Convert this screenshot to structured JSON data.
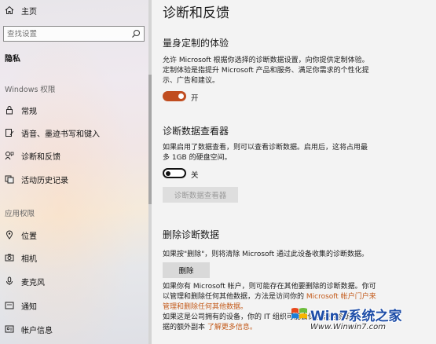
{
  "sidebar": {
    "home_label": "主页",
    "search_placeholder": "查找设置",
    "category": "隐私",
    "section_windows": "Windows 权限",
    "windows_items": [
      {
        "label": "常规"
      },
      {
        "label": "语音、墨迹书写和键入"
      },
      {
        "label": "诊断和反馈"
      },
      {
        "label": "活动历史记录"
      }
    ],
    "section_app": "应用权限",
    "app_items": [
      {
        "label": "位置"
      },
      {
        "label": "相机"
      },
      {
        "label": "麦克风"
      },
      {
        "label": "通知"
      },
      {
        "label": "帐户信息"
      }
    ]
  },
  "main": {
    "title": "诊断和反馈",
    "tailored": {
      "heading": "量身定制的体验",
      "line1": "允许 Microsoft 根据你选择的诊断数据设置，向你提供定制体验。",
      "line2": "定制体验是指提升 Microsoft 产品和服务、满足你需求的个性化提",
      "line3": "示、广告和建议。",
      "toggle_state": "开"
    },
    "viewer": {
      "heading": "诊断数据查看器",
      "line1": "如果启用了数据查看，则可以查看诊断数据。启用后，这将占用最",
      "line2": "多 1GB 的硬盘空间。",
      "toggle_state": "关",
      "button": "诊断数据查看器"
    },
    "delete": {
      "heading": "删除诊断数据",
      "line1": "如果按\"删除\"，则将清除 Microsoft 通过此设备收集的诊断数据。",
      "button": "删除",
      "p2_line1": "如果你有 Microsoft 帐户，则可能存在其他要删除的诊断数据。你可",
      "p2_line2a": "以管理和删除任何其他数据，方法是访问你的 ",
      "p2_link1": "Microsoft 帐户门户来",
      "p2_link2": "管理和删除任何其他数据。",
      "p3_line1": "如果这是公司拥有的设备，你的 IT 组织可能会保留这些诊断数",
      "p3_line2a": "据的额外副本 ",
      "p3_link": "了解更多信息。"
    }
  },
  "watermark": {
    "brand": "Win7系统之家",
    "url": "Www.Winwin7.com"
  },
  "colors": {
    "accent": "#c04d20",
    "link": "#c35a1a",
    "watermark": "#1f4ea8"
  }
}
